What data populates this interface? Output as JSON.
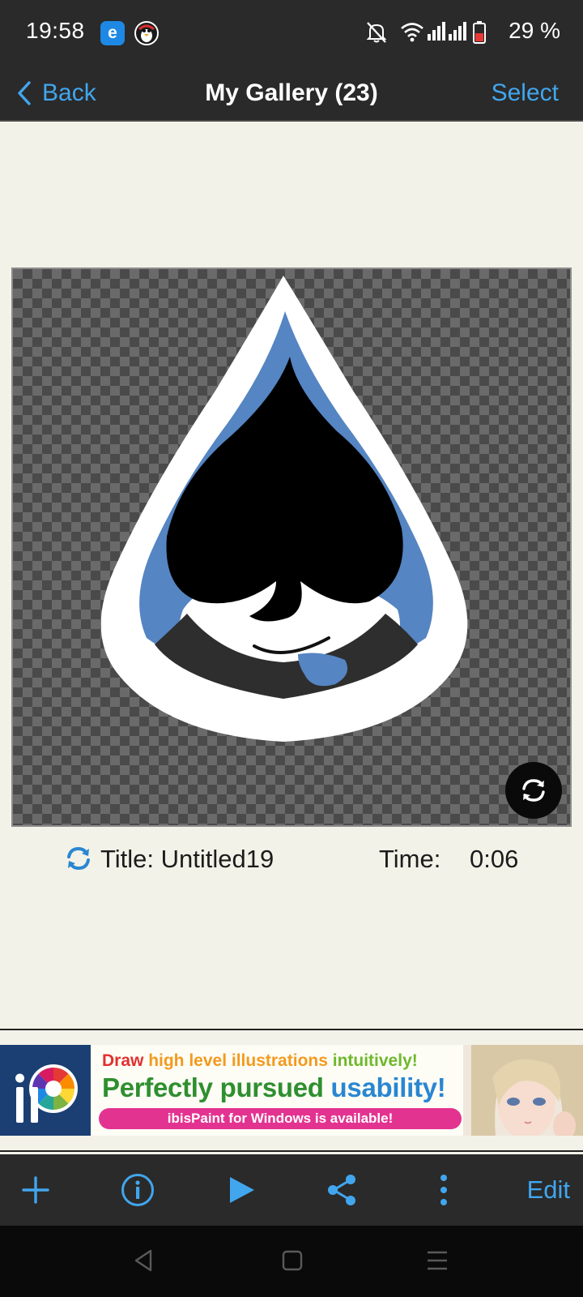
{
  "status_bar": {
    "time": "19:58",
    "battery_percent": "29 %",
    "icons": [
      "browser-e-icon",
      "penguin-app-icon",
      "mute-notifications-icon",
      "wifi-icon",
      "signal-icon",
      "signal-icon",
      "battery-low-icon"
    ]
  },
  "nav": {
    "back_label": "Back",
    "title": "My Gallery (23)",
    "select_label": "Select"
  },
  "artwork": {
    "description_icon": "spade-drop-artwork",
    "rotate_icon": "rotate-icon"
  },
  "info": {
    "title_text": "Title: Untitled19",
    "time_label": "Time:",
    "time_value": "0:06"
  },
  "ad": {
    "line1_draw": "Draw ",
    "line1_high": "high level illustrations ",
    "line1_intuitive": "intuitively!",
    "line2_perfectly": "Perfectly pursued ",
    "line2_usability": "usability!",
    "pill_text": "ibisPaint for Windows is available!",
    "colors": {
      "draw": "#e2302f",
      "high": "#f39a1e",
      "intuitive": "#6fb82b",
      "perfectly": "#2f8f2f",
      "usability": "#2a86d1",
      "pill": "#e33391"
    }
  },
  "toolbar": {
    "edit_label": "Edit",
    "icons": [
      "add-icon",
      "info-icon",
      "play-icon",
      "share-icon",
      "more-icon"
    ]
  },
  "colors": {
    "accent": "#41a6ee",
    "bar": "#2a2a2a",
    "background": "#f3f2e8"
  }
}
